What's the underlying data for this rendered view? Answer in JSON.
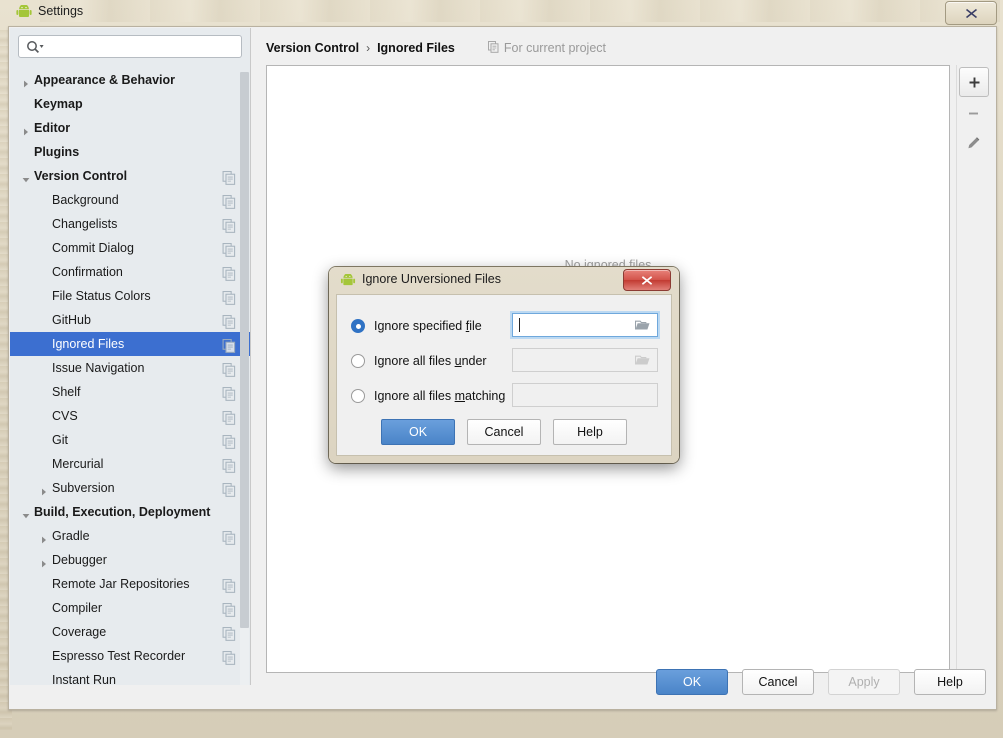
{
  "window": {
    "title": "Settings",
    "icon": "android-icon",
    "close_label": "✕"
  },
  "sidebar": {
    "search": {
      "placeholder": "",
      "value": "",
      "icon": "search-icon"
    },
    "items": [
      {
        "label": "Appearance & Behavior",
        "indent": 0,
        "arrow": "collapsed",
        "bold": true,
        "copy": false,
        "selected": false
      },
      {
        "label": "Keymap",
        "indent": 0,
        "arrow": "none",
        "bold": true,
        "copy": false,
        "selected": false
      },
      {
        "label": "Editor",
        "indent": 0,
        "arrow": "collapsed",
        "bold": true,
        "copy": false,
        "selected": false
      },
      {
        "label": "Plugins",
        "indent": 0,
        "arrow": "none",
        "bold": true,
        "copy": false,
        "selected": false
      },
      {
        "label": "Version Control",
        "indent": 0,
        "arrow": "expanded",
        "bold": true,
        "copy": true,
        "selected": false
      },
      {
        "label": "Background",
        "indent": 1,
        "arrow": "none",
        "bold": false,
        "copy": true,
        "selected": false
      },
      {
        "label": "Changelists",
        "indent": 1,
        "arrow": "none",
        "bold": false,
        "copy": true,
        "selected": false
      },
      {
        "label": "Commit Dialog",
        "indent": 1,
        "arrow": "none",
        "bold": false,
        "copy": true,
        "selected": false
      },
      {
        "label": "Confirmation",
        "indent": 1,
        "arrow": "none",
        "bold": false,
        "copy": true,
        "selected": false
      },
      {
        "label": "File Status Colors",
        "indent": 1,
        "arrow": "none",
        "bold": false,
        "copy": true,
        "selected": false
      },
      {
        "label": "GitHub",
        "indent": 1,
        "arrow": "none",
        "bold": false,
        "copy": true,
        "selected": false
      },
      {
        "label": "Ignored Files",
        "indent": 1,
        "arrow": "none",
        "bold": false,
        "copy": true,
        "selected": true
      },
      {
        "label": "Issue Navigation",
        "indent": 1,
        "arrow": "none",
        "bold": false,
        "copy": true,
        "selected": false
      },
      {
        "label": "Shelf",
        "indent": 1,
        "arrow": "none",
        "bold": false,
        "copy": true,
        "selected": false
      },
      {
        "label": "CVS",
        "indent": 1,
        "arrow": "none",
        "bold": false,
        "copy": true,
        "selected": false
      },
      {
        "label": "Git",
        "indent": 1,
        "arrow": "none",
        "bold": false,
        "copy": true,
        "selected": false
      },
      {
        "label": "Mercurial",
        "indent": 1,
        "arrow": "none",
        "bold": false,
        "copy": true,
        "selected": false
      },
      {
        "label": "Subversion",
        "indent": 1,
        "arrow": "collapsed",
        "bold": false,
        "copy": true,
        "selected": false
      },
      {
        "label": "Build, Execution, Deployment",
        "indent": 0,
        "arrow": "expanded",
        "bold": true,
        "copy": false,
        "selected": false
      },
      {
        "label": "Gradle",
        "indent": 1,
        "arrow": "collapsed",
        "bold": false,
        "copy": true,
        "selected": false
      },
      {
        "label": "Debugger",
        "indent": 1,
        "arrow": "collapsed",
        "bold": false,
        "copy": false,
        "selected": false
      },
      {
        "label": "Remote Jar Repositories",
        "indent": 1,
        "arrow": "none",
        "bold": false,
        "copy": true,
        "selected": false
      },
      {
        "label": "Compiler",
        "indent": 1,
        "arrow": "none",
        "bold": false,
        "copy": true,
        "selected": false
      },
      {
        "label": "Coverage",
        "indent": 1,
        "arrow": "none",
        "bold": false,
        "copy": true,
        "selected": false
      },
      {
        "label": "Espresso Test Recorder",
        "indent": 1,
        "arrow": "none",
        "bold": false,
        "copy": true,
        "selected": false
      },
      {
        "label": "Instant Run",
        "indent": 1,
        "arrow": "none",
        "bold": false,
        "copy": false,
        "selected": false
      }
    ]
  },
  "panel": {
    "breadcrumb": {
      "parent": "Version Control",
      "separator": "›",
      "current": "Ignored Files"
    },
    "scope_label": "For current project",
    "scope_icon": "copy-icon",
    "empty_message": "No ignored files",
    "tools": [
      {
        "name": "add-button",
        "glyph": "+"
      },
      {
        "name": "remove-button",
        "glyph": "−"
      },
      {
        "name": "edit-button",
        "glyph": "pencil"
      }
    ]
  },
  "footer": {
    "ok": "OK",
    "cancel": "Cancel",
    "apply": "Apply",
    "help": "Help"
  },
  "dialog": {
    "title": "Ignore Unversioned Files",
    "icon": "android-icon",
    "close_label": "✕",
    "options": [
      {
        "label_before": "Ignore specified ",
        "mnemonic": "f",
        "label_after": "ile",
        "selected": true,
        "has_field": true,
        "field_enabled": true,
        "field_value": "",
        "has_browse": true
      },
      {
        "label_before": "Ignore all files ",
        "mnemonic": "u",
        "label_after": "nder",
        "selected": false,
        "has_field": true,
        "field_enabled": false,
        "field_value": "",
        "has_browse": true
      },
      {
        "label_before": "Ignore all files ",
        "mnemonic": "m",
        "label_after": "atching",
        "selected": false,
        "has_field": true,
        "field_enabled": false,
        "field_value": "",
        "has_browse": false
      }
    ],
    "buttons": {
      "ok": "OK",
      "cancel": "Cancel",
      "help": "Help"
    }
  },
  "colors": {
    "selection": "#3c6fd0",
    "primary_button": "#4a84c8",
    "close_red": "#c23b32",
    "chrome": "#ded6c2",
    "panel_bg": "#f0f0f0",
    "sidebar_bg": "#e7ebee"
  }
}
